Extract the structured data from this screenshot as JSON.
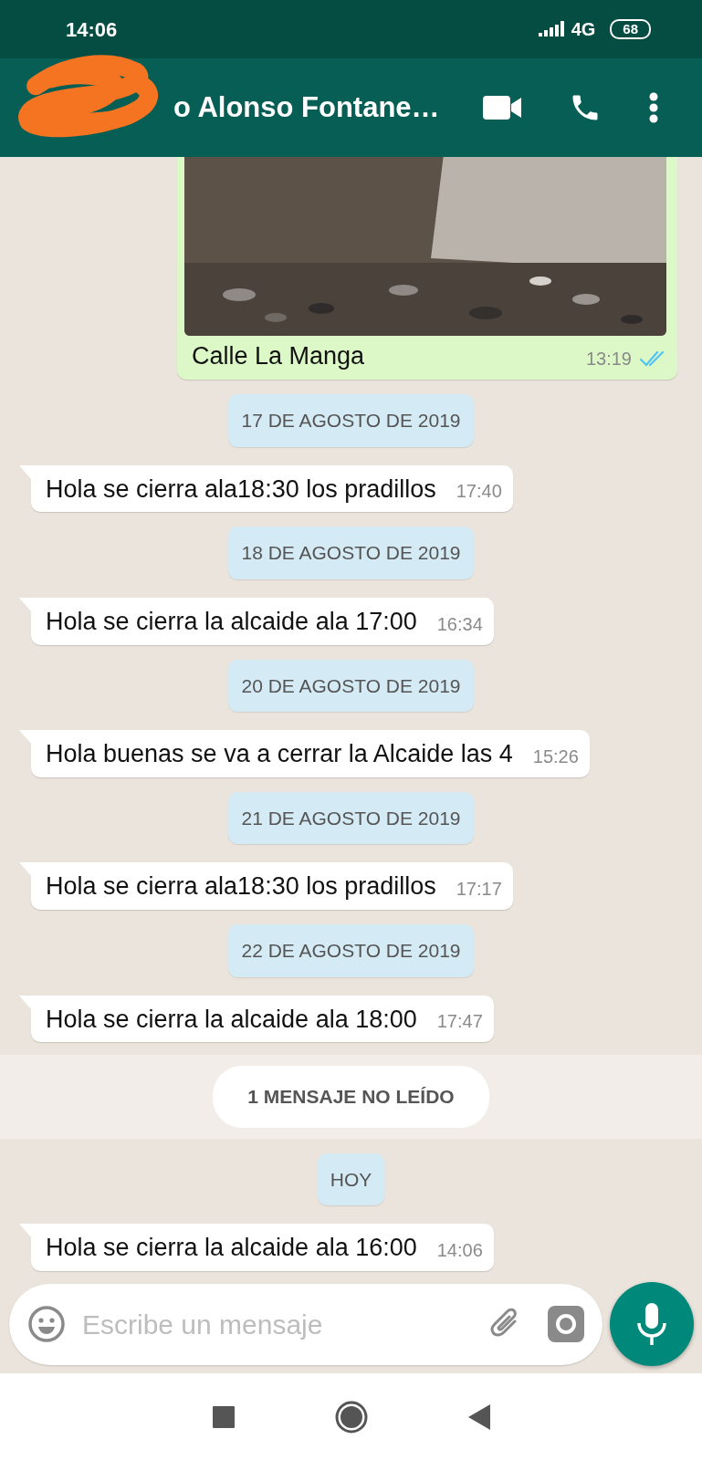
{
  "status_bar": {
    "time": "14:06",
    "network": "4G",
    "battery": "68"
  },
  "header": {
    "contact_name": "o Alonso Fontane…"
  },
  "messages": [
    {
      "caption": "Calle La Manga",
      "time": "13:19",
      "outgoing": true,
      "read": true
    },
    {
      "kind": "date",
      "text": "17 DE AGOSTO DE 2019"
    },
    {
      "kind": "text",
      "text": "Hola se cierra ala18:30 los pradillos",
      "time": "17:40",
      "outgoing": false
    },
    {
      "kind": "date",
      "text": "18 DE AGOSTO DE 2019"
    },
    {
      "kind": "text",
      "text": "Hola se cierra la alcaide ala 17:00",
      "time": "16:34",
      "outgoing": false
    },
    {
      "kind": "date",
      "text": "20 DE AGOSTO DE 2019"
    },
    {
      "kind": "text",
      "text": "Hola buenas se va a cerrar la Alcaide las 4",
      "time": "15:26",
      "outgoing": false
    },
    {
      "kind": "date",
      "text": "21 DE AGOSTO DE 2019"
    },
    {
      "kind": "text",
      "text": "Hola se cierra ala18:30 los pradillos",
      "time": "17:17",
      "outgoing": false
    },
    {
      "kind": "date",
      "text": "22 DE AGOSTO DE 2019"
    },
    {
      "kind": "text",
      "text": "Hola se cierra la alcaide ala 18:00",
      "time": "17:47",
      "outgoing": false
    },
    {
      "kind": "unread",
      "text": "1 MENSAJE NO LEÍDO"
    },
    {
      "kind": "date",
      "text": "HOY"
    },
    {
      "kind": "text",
      "text": "Hola se cierra la alcaide ala 16:00",
      "time": "14:06",
      "outgoing": false
    }
  ],
  "composer": {
    "placeholder": "Escribe un mensaje"
  }
}
